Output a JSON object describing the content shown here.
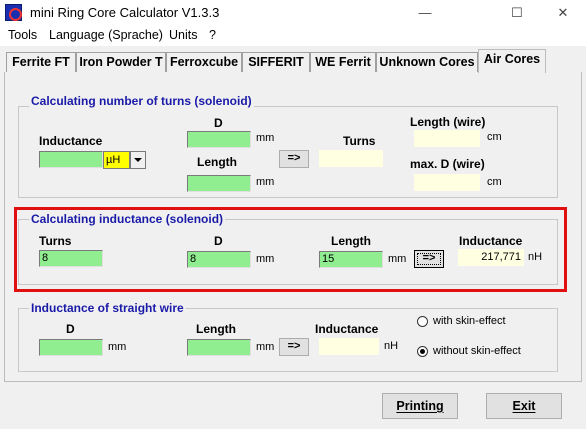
{
  "window": {
    "title": "mini Ring Core Calculator V1.3.3",
    "minimize": "—",
    "maximize": "☐",
    "close": "✕"
  },
  "menu": [
    "Tools",
    "Language (Sprache)",
    "Units",
    "?"
  ],
  "tabs": [
    "Ferrite FT",
    "Iron Powder T",
    "Ferroxcube",
    "SIFFERIT",
    "WE Ferrit",
    "Unknown Cores",
    "Air Cores"
  ],
  "active_tab": "Air Cores",
  "turns_group": {
    "title": "Calculating number of turns (solenoid)",
    "inductance_label": "Inductance",
    "inductance_value": "",
    "inductance_unit": "µH",
    "d_label": "D",
    "d_value": "",
    "d_unit": "mm",
    "length_label": "Length",
    "length_value": "",
    "length_unit": "mm",
    "calc_button": "=>",
    "turns_label": "Turns",
    "turns_result": "",
    "wire_length_label": "Length (wire)",
    "wire_length_result": "",
    "wire_length_unit": "cm",
    "max_d_label": "max. D (wire)",
    "max_d_result": "",
    "max_d_unit": "cm"
  },
  "inductance_group": {
    "title": "Calculating inductance (solenoid)",
    "turns_label": "Turns",
    "turns_value": "8",
    "d_label": "D",
    "d_value": "8",
    "d_unit": "mm",
    "length_label": "Length",
    "length_value": "15",
    "length_unit": "mm",
    "calc_button": "=>",
    "inductance_label": "Inductance",
    "inductance_result": "217,771",
    "inductance_unit": "nH"
  },
  "wire_group": {
    "title": "Inductance of straight wire",
    "d_label": "D",
    "d_value": "",
    "d_unit": "mm",
    "length_label": "Length",
    "length_value": "",
    "length_unit": "mm",
    "calc_button": "=>",
    "inductance_label": "Inductance",
    "inductance_result": "",
    "inductance_unit": "nH",
    "skin_on": "with skin-effect",
    "skin_off": "without skin-effect",
    "skin_selected": "without skin-effect"
  },
  "buttons": {
    "printing": "Printing",
    "exit": "Exit"
  },
  "colors": {
    "input_bg": "#90ee90",
    "result_bg": "#ffffe1",
    "group_title": "#1a1aa8",
    "highlight": "#e01010",
    "unit_combo": "#ffff00"
  }
}
